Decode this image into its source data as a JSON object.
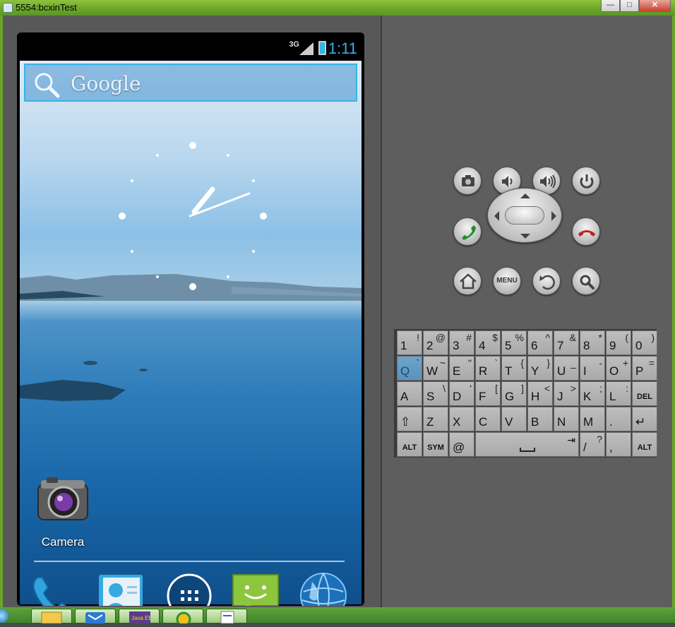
{
  "window": {
    "title": "5554:bcxinTest",
    "minimize_label": "—",
    "maximize_label": "□",
    "close_label": "✕"
  },
  "status_bar": {
    "network_label": "3G",
    "time": "1:11",
    "accent_color": "#33b5e5"
  },
  "search_widget": {
    "label": "Google",
    "icon": "search-icon"
  },
  "home": {
    "apps": [
      {
        "label": "Camera",
        "icon": "camera-icon"
      }
    ],
    "dock": [
      {
        "icon": "phone-icon"
      },
      {
        "icon": "contacts-icon"
      },
      {
        "icon": "app-drawer-icon"
      },
      {
        "icon": "messaging-icon"
      },
      {
        "icon": "browser-icon"
      }
    ]
  },
  "controls": {
    "buttons": [
      {
        "name": "camera-button",
        "icon": "camera-icon"
      },
      {
        "name": "volume-down-button",
        "icon": "volume-down-icon"
      },
      {
        "name": "volume-up-button",
        "icon": "volume-up-icon"
      },
      {
        "name": "power-button",
        "icon": "power-icon"
      },
      {
        "name": "call-button",
        "icon": "call-icon"
      },
      {
        "name": "end-call-button",
        "icon": "end-call-icon"
      },
      {
        "name": "home-button",
        "icon": "home-icon"
      },
      {
        "name": "menu-button",
        "label": "MENU"
      },
      {
        "name": "back-button",
        "icon": "back-icon"
      },
      {
        "name": "search-button",
        "icon": "search-icon"
      }
    ]
  },
  "keyboard": {
    "rows": [
      [
        {
          "m": "1",
          "a": "!"
        },
        {
          "m": "2",
          "a": "@"
        },
        {
          "m": "3",
          "a": "#"
        },
        {
          "m": "4",
          "a": "$"
        },
        {
          "m": "5",
          "a": "%"
        },
        {
          "m": "6",
          "a": "^"
        },
        {
          "m": "7",
          "a": "&"
        },
        {
          "m": "8",
          "a": "*"
        },
        {
          "m": "9",
          "a": "("
        },
        {
          "m": "0",
          "a": ")"
        }
      ],
      [
        {
          "m": "Q",
          "a": "`"
        },
        {
          "m": "W",
          "a": "~"
        },
        {
          "m": "E",
          "a": "\""
        },
        {
          "m": "R",
          "a": "`"
        },
        {
          "m": "T",
          "a": "{"
        },
        {
          "m": "Y",
          "a": "}"
        },
        {
          "m": "U",
          "a": "_"
        },
        {
          "m": "I",
          "a": "-"
        },
        {
          "m": "O",
          "a": "+"
        },
        {
          "m": "P",
          "a": "="
        }
      ],
      [
        {
          "m": "A",
          "a": ""
        },
        {
          "m": "S",
          "a": "\\"
        },
        {
          "m": "D",
          "a": "'"
        },
        {
          "m": "F",
          "a": "["
        },
        {
          "m": "G",
          "a": "]"
        },
        {
          "m": "H",
          "a": "<"
        },
        {
          "m": "J",
          "a": ">"
        },
        {
          "m": "K",
          "a": ";"
        },
        {
          "m": "L",
          "a": ":"
        },
        {
          "m": "DEL",
          "a": ""
        }
      ],
      [
        {
          "m": "⇧",
          "a": ""
        },
        {
          "m": "Z",
          "a": ""
        },
        {
          "m": "X",
          "a": ""
        },
        {
          "m": "C",
          "a": ""
        },
        {
          "m": "V",
          "a": ""
        },
        {
          "m": "B",
          "a": ""
        },
        {
          "m": "N",
          "a": ""
        },
        {
          "m": "M",
          "a": ""
        },
        {
          "m": ".",
          "a": ""
        },
        {
          "m": "↵",
          "a": ""
        }
      ]
    ],
    "bottom_row": {
      "alt_left": "ALT",
      "sym": "SYM",
      "at": "@",
      "space_tab": "⇥",
      "slash": "/",
      "question": "?",
      "comma": ",",
      "alt_right": "ALT"
    },
    "highlight_color": "#5a92bd"
  },
  "taskbar": {
    "items": [
      {
        "icon": "folder-icon"
      },
      {
        "icon": "mail-icon"
      },
      {
        "icon": "java-ee-icon"
      },
      {
        "icon": "browser-icon"
      },
      {
        "icon": "document-icon"
      }
    ]
  }
}
